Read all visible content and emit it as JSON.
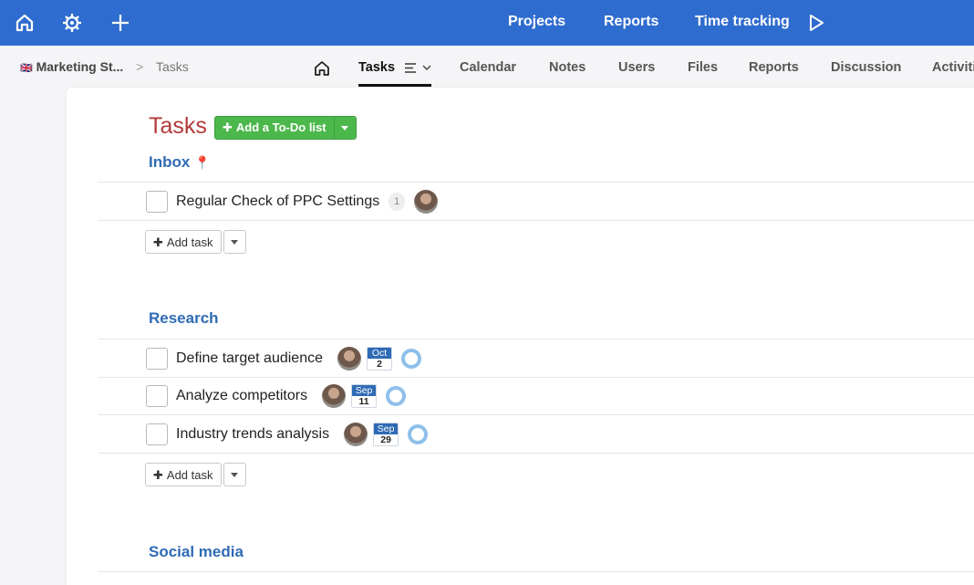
{
  "topbar": {
    "nav": [
      "Projects",
      "Reports",
      "Time tracking"
    ],
    "icons": [
      "home-icon",
      "settings-icon",
      "plus-icon",
      "play-icon"
    ]
  },
  "breadcrumb": {
    "flag": "🇬🇧",
    "project": "Marketing St...",
    "separator": ">",
    "current": "Tasks"
  },
  "tabs": [
    "Tasks",
    "Calendar",
    "Notes",
    "Users",
    "Files",
    "Reports",
    "Discussion",
    "Activiti"
  ],
  "page": {
    "title": "Tasks",
    "add_list_label": "Add a To-Do list"
  },
  "lists": [
    {
      "title": "Inbox",
      "pin": "📍",
      "tasks": [
        {
          "name": "Regular Check of PPC Settings",
          "count": "1"
        }
      ],
      "add_task_label": "Add task"
    },
    {
      "title": "Research",
      "tasks": [
        {
          "name": "Define target audience",
          "month": "Oct",
          "day": "2"
        },
        {
          "name": "Analyze competitors",
          "month": "Sep",
          "day": "11"
        },
        {
          "name": "Industry trends analysis",
          "month": "Sep",
          "day": "29"
        }
      ],
      "add_task_label": "Add task"
    },
    {
      "title": "Social media"
    }
  ],
  "colors": {
    "topbar": "#2f6ccf",
    "title": "#b33a3a",
    "list_title": "#2f6bb5",
    "add_list_button": "#4cb84c"
  }
}
